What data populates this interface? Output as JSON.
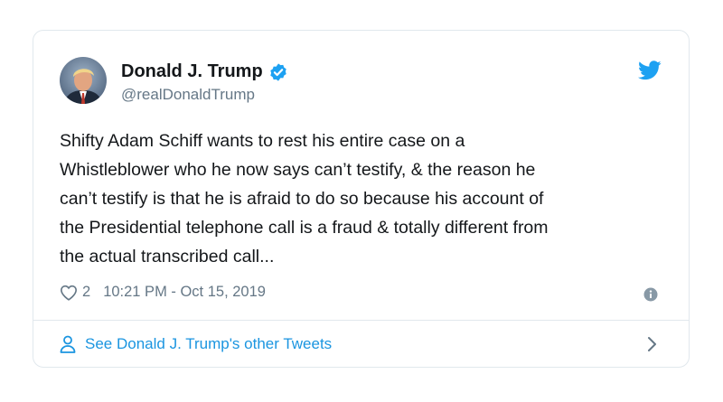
{
  "author": {
    "display_name": "Donald J. Trump",
    "handle": "@realDonaldTrump",
    "verified": true
  },
  "tweet": {
    "lines": [
      "Shifty Adam Schiff wants to rest his entire case on a",
      "Whistleblower who he now says can’t testify, & the reason he",
      "can’t testify is that he is afraid to do so because his account of",
      "the Presidential telephone call is a fraud & totally different from",
      "the actual transcribed call..."
    ],
    "likes": "2",
    "timestamp": "10:21 PM - Oct 15, 2019"
  },
  "footer": {
    "label": "See Donald J. Trump's other Tweets"
  },
  "icons": {
    "verified": "verified-badge-icon",
    "bird": "twitter-bird-icon",
    "heart": "heart-icon",
    "info": "info-icon",
    "person": "person-icon",
    "chevron": "chevron-right-icon"
  },
  "colors": {
    "brand_blue": "#1da1f2",
    "link_blue": "#1b95e0",
    "text": "#14171a",
    "secondary": "#657786",
    "border": "#e1e8ed"
  }
}
